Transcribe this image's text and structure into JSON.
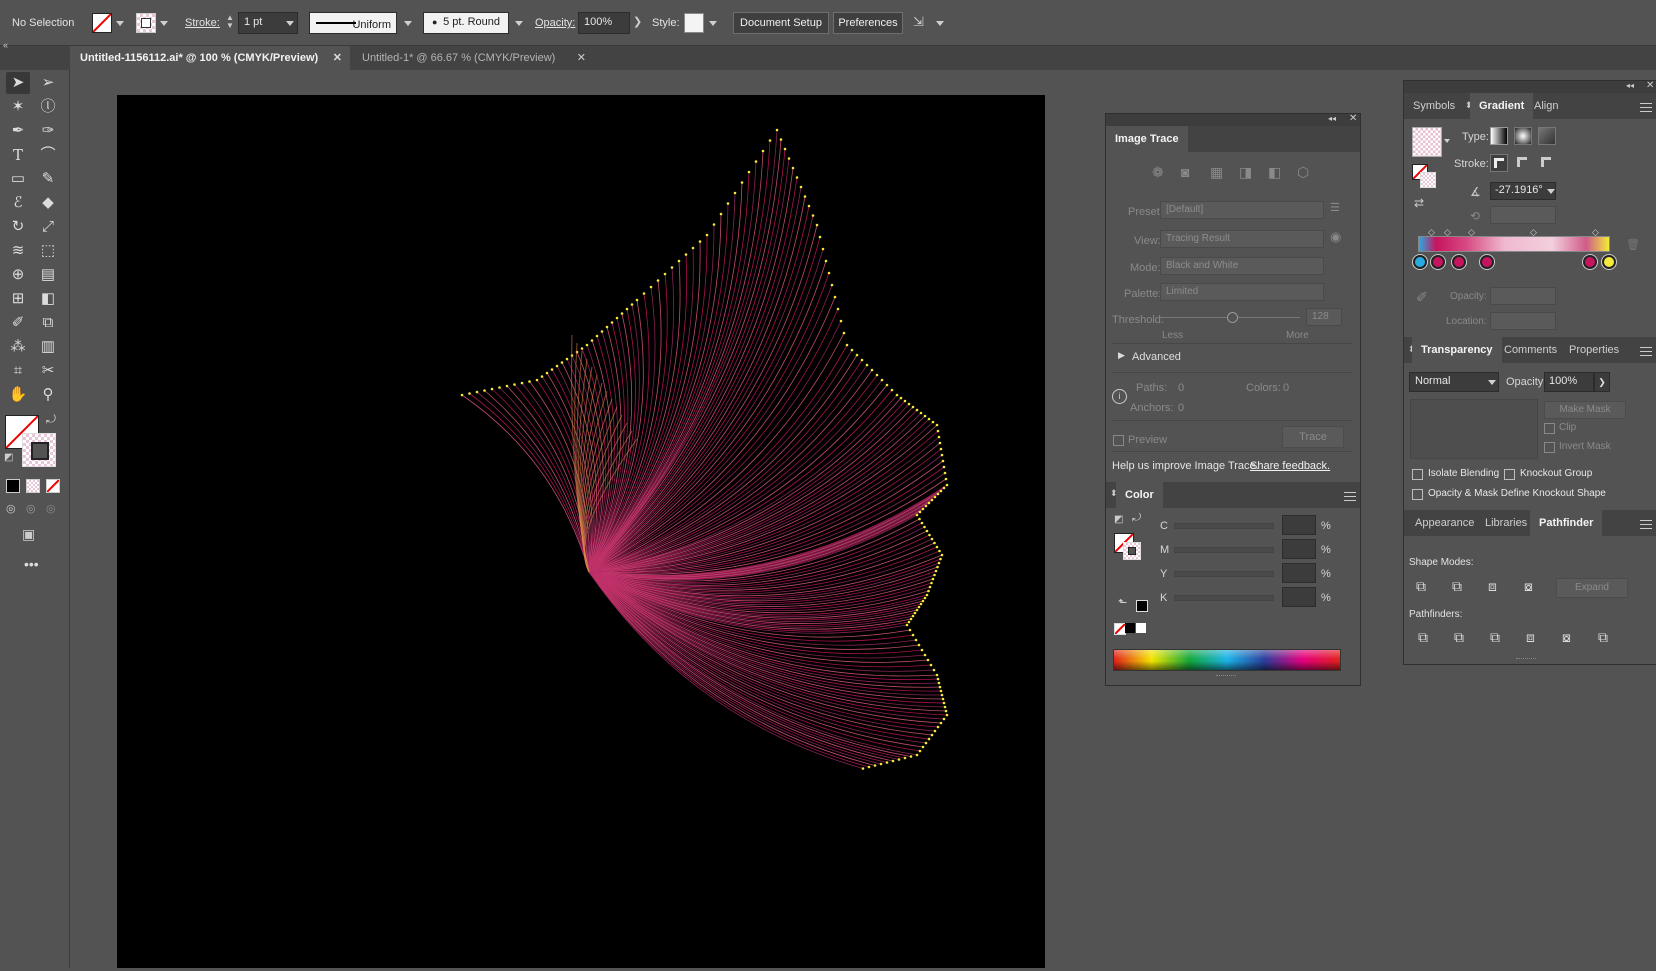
{
  "control_bar": {
    "selection": "No Selection",
    "stroke_label": "Stroke:",
    "stroke_weight": "1 pt",
    "profile": "Uniform",
    "brush": "5 pt. Round",
    "opacity_label": "Opacity:",
    "opacity_value": "100%",
    "style_label": "Style:",
    "document_setup": "Document Setup",
    "preferences": "Preferences"
  },
  "tabs": [
    {
      "label": "Untitled-1156112.ai* @ 100 % (CMYK/Preview)",
      "active": true
    },
    {
      "label": "Untitled-1* @ 66.67 % (CMYK/Preview)",
      "active": false
    }
  ],
  "image_trace": {
    "title": "Image Trace",
    "preset_label": "Preset:",
    "preset_value": "[Default]",
    "view_label": "View:",
    "view_value": "Tracing Result",
    "mode_label": "Mode:",
    "mode_value": "Black and White",
    "palette_label": "Palette:",
    "palette_value": "Limited",
    "threshold_label": "Threshold:",
    "threshold_value": "128",
    "less": "Less",
    "more": "More",
    "advanced": "Advanced",
    "paths_label": "Paths:",
    "paths_value": "0",
    "colors_label": "Colors:",
    "colors_value": "0",
    "anchors_label": "Anchors:",
    "anchors_value": "0",
    "preview": "Preview",
    "trace": "Trace",
    "help": "Help us improve Image Trace.",
    "feedback": "Share feedback."
  },
  "color_panel": {
    "title": "Color",
    "channels": [
      "C",
      "M",
      "Y",
      "K"
    ],
    "percent": "%"
  },
  "gradient_panel": {
    "tabs": [
      "Symbols",
      "Gradient",
      "Align"
    ],
    "type_label": "Type:",
    "stroke_label": "Stroke:",
    "angle": "-27.1916°",
    "opacity_label": "Opacity:",
    "location_label": "Location:",
    "colors": {
      "cyan": "#29abe2",
      "magenta": "#c7145e",
      "yellow": "#f4ea3a"
    }
  },
  "transparency_panel": {
    "tabs": [
      "Transparency",
      "Comments",
      "Properties"
    ],
    "blend_mode": "Normal",
    "opacity_label": "Opacity:",
    "opacity_value": "100%",
    "make_mask": "Make Mask",
    "clip": "Clip",
    "invert_mask": "Invert Mask",
    "isolate": "Isolate Blending",
    "knockout": "Knockout Group",
    "opacity_mask": "Opacity & Mask Define Knockout Shape"
  },
  "pathfinder_panel": {
    "tabs": [
      "Appearance",
      "Libraries",
      "Pathfinder"
    ],
    "shape_modes": "Shape Modes:",
    "expand": "Expand",
    "pathfinders": "Pathfinders:"
  }
}
